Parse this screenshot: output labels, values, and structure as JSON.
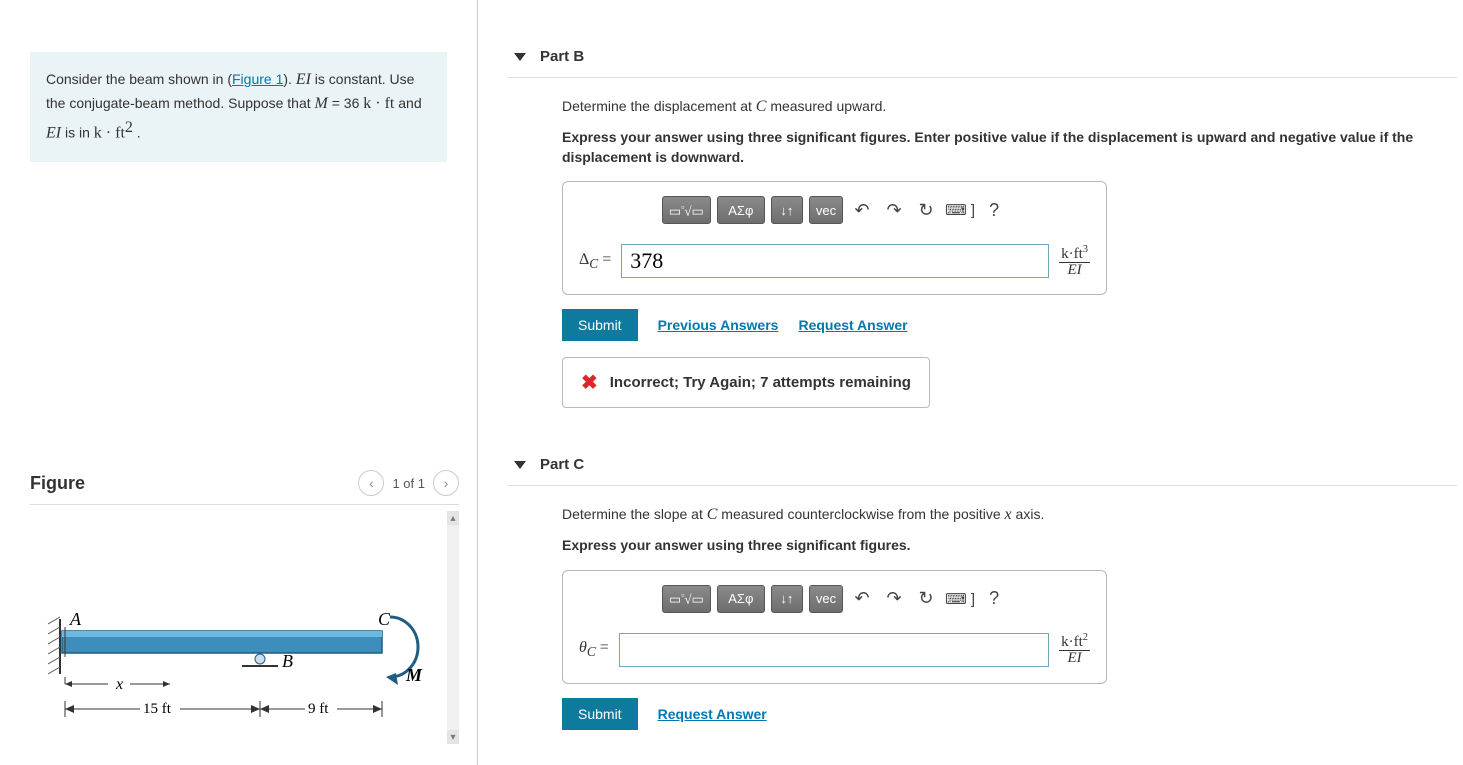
{
  "problem": {
    "pre": "Consider the beam shown in (",
    "link": "Figure 1",
    "post1": "). ",
    "s1a": "EI",
    "s1b": " is constant. Use the conjugate-beam method. Suppose that ",
    "s1c": "M",
    "s1d": " = 36 ",
    "s1e": "k · ft",
    "s1f": " and ",
    "s1g": "EI",
    "s1h": " is in ",
    "s1i": "k · ft",
    "s1j": "2",
    "s1k": " ."
  },
  "figure": {
    "title": "Figure",
    "nav": "1 of 1",
    "labels": {
      "A": "A",
      "B": "B",
      "C": "C",
      "M": "M",
      "x": "x",
      "d1": "15 ft",
      "d2": "9 ft"
    }
  },
  "partB": {
    "title": "Part B",
    "desc_pre": "Determine the displacement at ",
    "desc_var": "C",
    "desc_post": " measured upward.",
    "instr": "Express your answer using three significant figures. Enter positive value if the displacement is upward and negative value if the displacement is downward.",
    "toolbar": {
      "templates": "▭√▭",
      "greek": "ΑΣφ",
      "updown": "↓↑",
      "vec": "vec"
    },
    "icons": {
      "undo": "↶",
      "redo": "↷",
      "reset": "↻",
      "kbd": "⌨ ]",
      "help": "?"
    },
    "var_label": "Δ",
    "var_sub": "C",
    "eq": " = ",
    "value": "378",
    "units_num": "k·ft",
    "units_exp": "3",
    "units_den": "EI",
    "submit": "Submit",
    "prev": "Previous Answers",
    "req": "Request Answer",
    "feedback": "Incorrect; Try Again; 7 attempts remaining"
  },
  "partC": {
    "title": "Part C",
    "desc_pre": "Determine the slope at ",
    "desc_var": "C",
    "desc_mid": " measured counterclockwise from the positive ",
    "desc_var2": "x",
    "desc_post": " axis.",
    "instr": "Express your answer using three significant figures.",
    "var_label": "θ",
    "var_sub": "C",
    "eq": " = ",
    "value": "",
    "units_num": "k·ft",
    "units_exp": "2",
    "units_den": "EI",
    "submit": "Submit",
    "req": "Request Answer"
  }
}
